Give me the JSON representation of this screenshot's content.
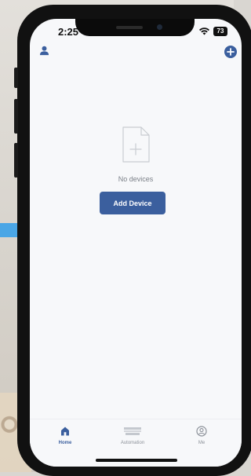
{
  "status_bar": {
    "time": "2:25",
    "battery": "73"
  },
  "header": {
    "left_icon": "user-icon",
    "right_icon": "add-circle-icon"
  },
  "empty_state": {
    "icon": "file-add-icon",
    "message": "No devices"
  },
  "primary_action": {
    "label": "Add Device"
  },
  "tabs": [
    {
      "label": "Home",
      "icon": "home-icon",
      "active": true
    },
    {
      "label": "Automation",
      "icon": "automation-icon",
      "active": false
    },
    {
      "label": "Me",
      "icon": "profile-icon",
      "active": false
    }
  ],
  "colors": {
    "accent": "#3b5f9e",
    "muted_text": "#7a7f87",
    "screen_bg": "#f7f8fa"
  }
}
